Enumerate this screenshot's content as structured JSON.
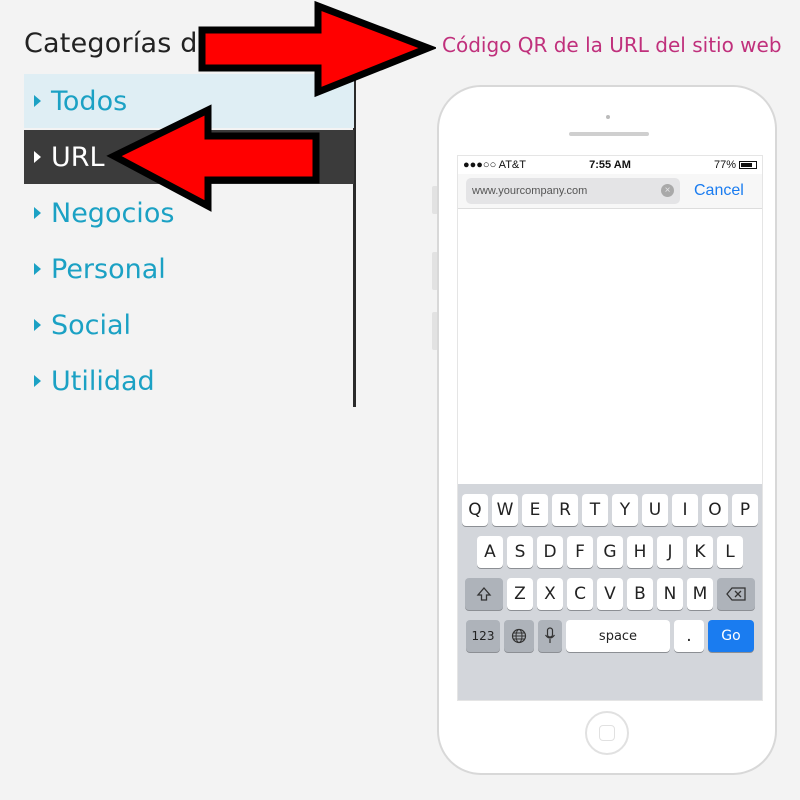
{
  "sidebar": {
    "title": "Categorías de",
    "items": [
      {
        "label": "Todos"
      },
      {
        "label": "URL"
      },
      {
        "label": "Negocios"
      },
      {
        "label": "Personal"
      },
      {
        "label": "Social"
      },
      {
        "label": "Utilidad"
      }
    ],
    "active_index": 1
  },
  "header": {
    "caption": "Código QR de la URL del sitio web"
  },
  "phone": {
    "status": {
      "carrier": "●●●○○ AT&T",
      "time": "7:55 AM",
      "battery": "77%"
    },
    "url_field": {
      "value": "www.yourcompany.com"
    },
    "cancel_label": "Cancel",
    "keyboard": {
      "row1": [
        "Q",
        "W",
        "E",
        "R",
        "T",
        "Y",
        "U",
        "I",
        "O",
        "P"
      ],
      "row2": [
        "A",
        "S",
        "D",
        "F",
        "G",
        "H",
        "J",
        "K",
        "L"
      ],
      "row3": [
        "Z",
        "X",
        "C",
        "V",
        "B",
        "N",
        "M"
      ],
      "numbers_label": "123",
      "space_label": "space",
      "period_label": ".",
      "go_label": "Go"
    }
  },
  "colors": {
    "accent_link": "#1ba1c4",
    "active_bg": "#3b3b3b",
    "header_caption": "#c0307c",
    "arrow": "#ff0000",
    "ios_blue": "#1a7cf0"
  }
}
